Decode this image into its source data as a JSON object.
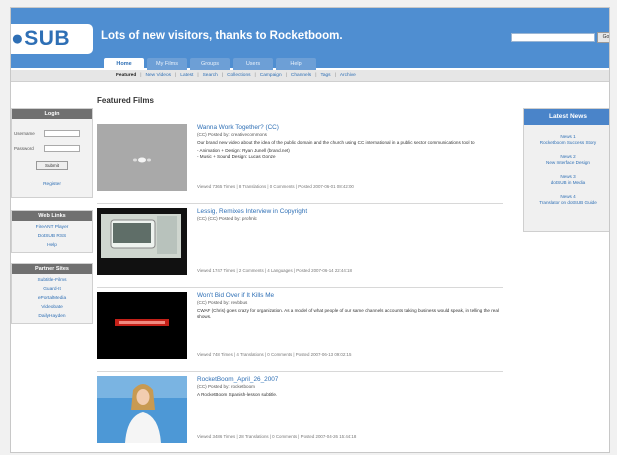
{
  "header": {
    "logo": "SUB",
    "tagline": "Lots of new visitors, thanks to Rocketboom.",
    "search_placeholder": "",
    "search_button": "Go",
    "tabs": [
      "Home",
      "My Films",
      "Groups",
      "Users",
      "Help"
    ],
    "accent": "#4f8ed1"
  },
  "subnav": [
    "Featured",
    "New Videos",
    "Latest",
    "Search",
    "Collections",
    "Campaign",
    "Channels",
    "Tags",
    "Archive"
  ],
  "sidebar": {
    "login": {
      "title": "Login",
      "username_label": "Username",
      "password_label": "Password",
      "submit": "Submit",
      "register": "Register"
    },
    "web_links": {
      "title": "Web Links",
      "items": [
        "FireANT Player",
        "DotSUB RSS",
        "Help"
      ]
    },
    "partner_sites": {
      "title": "Partner Sites",
      "items": [
        "Subtitle-Films",
        "Guard-It",
        "ePortalMedia",
        "Videobate",
        "DailyHayden"
      ]
    }
  },
  "main": {
    "title": "Featured Films",
    "films": [
      {
        "title": "Wanna Work Together? (CC)",
        "meta": "(CC) Posted by: creativecommons",
        "desc": "Our brand new video about the idea of the public domain and the church using CC international in a public sector communications tool to",
        "desc2": "- Animation + Design: Ryan Junell (brand.net)",
        "desc3": "- Music + Sound Design: Lucas Gonze",
        "stats": "Viewed 7365 Times | 8 Translations | 0 Comments | Posted 2007-06-01 08:42:00"
      },
      {
        "title": "Lessig, Remixes Interview in Copyright",
        "meta": "(CC) (CC) Posted by: profmlc",
        "desc": "",
        "desc2": "",
        "desc3": "",
        "stats": "Viewed 1747 Times | 2 Comments | 4 Languages | Posted 2007-06-14 22:44:18"
      },
      {
        "title": "Won't Bid Over if It Kills Me",
        "meta": "(CC) Posted by: revbbus",
        "desc": "CWAF (Chris) goes crazy for organization. As a model of what people of our same channels accounts taking business would speak, in telling the real shows.",
        "desc2": "",
        "desc3": "",
        "stats": "Viewed 748 Times | 4 Translations | 0 Comments | Posted 2007-06-13 09:02:15"
      },
      {
        "title": "RocketBoom_April_26_2007",
        "meta": "(CC) Posted by: rocketboom",
        "desc": "A RocketBoom Spanish-lesson subtitle.",
        "desc2": "",
        "desc3": "",
        "stats": "Viewed 3486 Times | 28 Translations | 0 Comments | Posted 2007-04-26 15:44:18"
      }
    ]
  },
  "right_sidebar": {
    "title": "Latest News",
    "items": [
      {
        "line1": "News 1",
        "line2": "Rocketboom Success Story"
      },
      {
        "line1": "News 2",
        "line2": "New Interface Design"
      },
      {
        "line1": "News 3",
        "line2": "dotSUB in Media"
      },
      {
        "line1": "News 4",
        "line2": "Translator on dotSUB Guide"
      }
    ]
  }
}
